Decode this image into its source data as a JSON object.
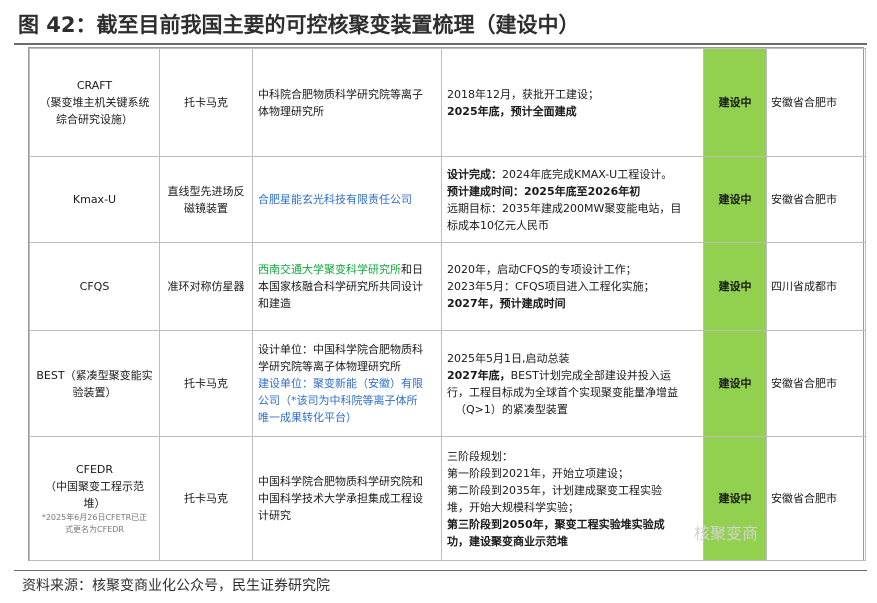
{
  "title": "图 42：截至目前我国主要的可控核聚变装置梳理（建设中）",
  "source": "资料来源：核聚变商业化公众号，民生证券研究院",
  "watermark": "核聚变商",
  "colors": {
    "status_green": "#92d050",
    "link_blue": "#2f6fc9",
    "text_green": "#11a83c"
  },
  "rows": [
    {
      "name": [
        "CRAFT",
        "（聚变堆主机关键系统",
        "综合研究设施）"
      ],
      "type": [
        "托卡马克"
      ],
      "unit": [
        "中科院合肥物质科学研究院等离子",
        "体物理研究所"
      ],
      "progress": [
        "2018年12月，获批开工建设；",
        "2025年底，预计全面建成"
      ],
      "status": "建设中",
      "location": "安徽省合肥市"
    },
    {
      "name": [
        "Kmax-U"
      ],
      "type": [
        "直线型先进场反",
        "磁镜装置"
      ],
      "unit": [
        "合肥星能玄光科技有限责任公司"
      ],
      "progress": [
        "设计完成：",
        "2024年底完成KMAX-U工程设计。",
        "预计建成时间：",
        "2025年底至2026年初",
        "远期目标：2035年建成200MW聚变能电站，目",
        "标成本10亿元人民币"
      ],
      "status": "建设中",
      "location": "安徽省合肥市"
    },
    {
      "name": [
        "CFQS"
      ],
      "type": [
        "准环对称仿星器"
      ],
      "unit": [
        "西南交通大学聚变科学研究所",
        "和日",
        "本国家核融合科学研究所共同设计",
        "和建造"
      ],
      "progress": [
        "2020年，启动CFQS的专项设计工作；",
        "2023年5月：CFQS项目进入工程化实施；",
        "2027年，预计建成时间"
      ],
      "status": "建设中",
      "location": "四川省成都市"
    },
    {
      "name": [
        "BEST（紧凑型聚变能实",
        "验装置）"
      ],
      "type": [
        "托卡马克"
      ],
      "unit": [
        "设计单位：中国科学院合肥物质科",
        "学研究院等离子体物理研究所",
        "建设单位：聚变新能（安徽）有限",
        "公司（*该司为中科院等离子体所",
        "唯一成果转化平台）"
      ],
      "progress": [
        "2025年5月1日,启动总装",
        "2027年底，",
        "BEST计划完成全部建设并投入运",
        "行，工程目标成为全球首个实现聚变能量净增益",
        "（Q>1）的紧凑型装置"
      ],
      "status": "建设中",
      "location": "安徽省合肥市"
    },
    {
      "name": [
        "CFEDR",
        "（中国聚变工程示范",
        "堆）",
        "*2025年6月26日CFETR已正",
        "式更名为CFEDR"
      ],
      "type": [
        "托卡马克"
      ],
      "unit": [
        "中国科学院合肥物质科学研究院和",
        "中国科学技术大学承担集成工程设",
        "计研究"
      ],
      "progress": [
        "三阶段规划：",
        "第一阶段到2021年，开始立项建设；",
        "第二阶段到2035年，计划建成聚变工程实验",
        "堆，开始大规模科学实验；",
        "第三阶段到2050年，聚变工程实验堆实验成",
        "功，建设聚变商业示范堆"
      ],
      "status": "建设中",
      "location": "安徽省合肥市"
    }
  ]
}
